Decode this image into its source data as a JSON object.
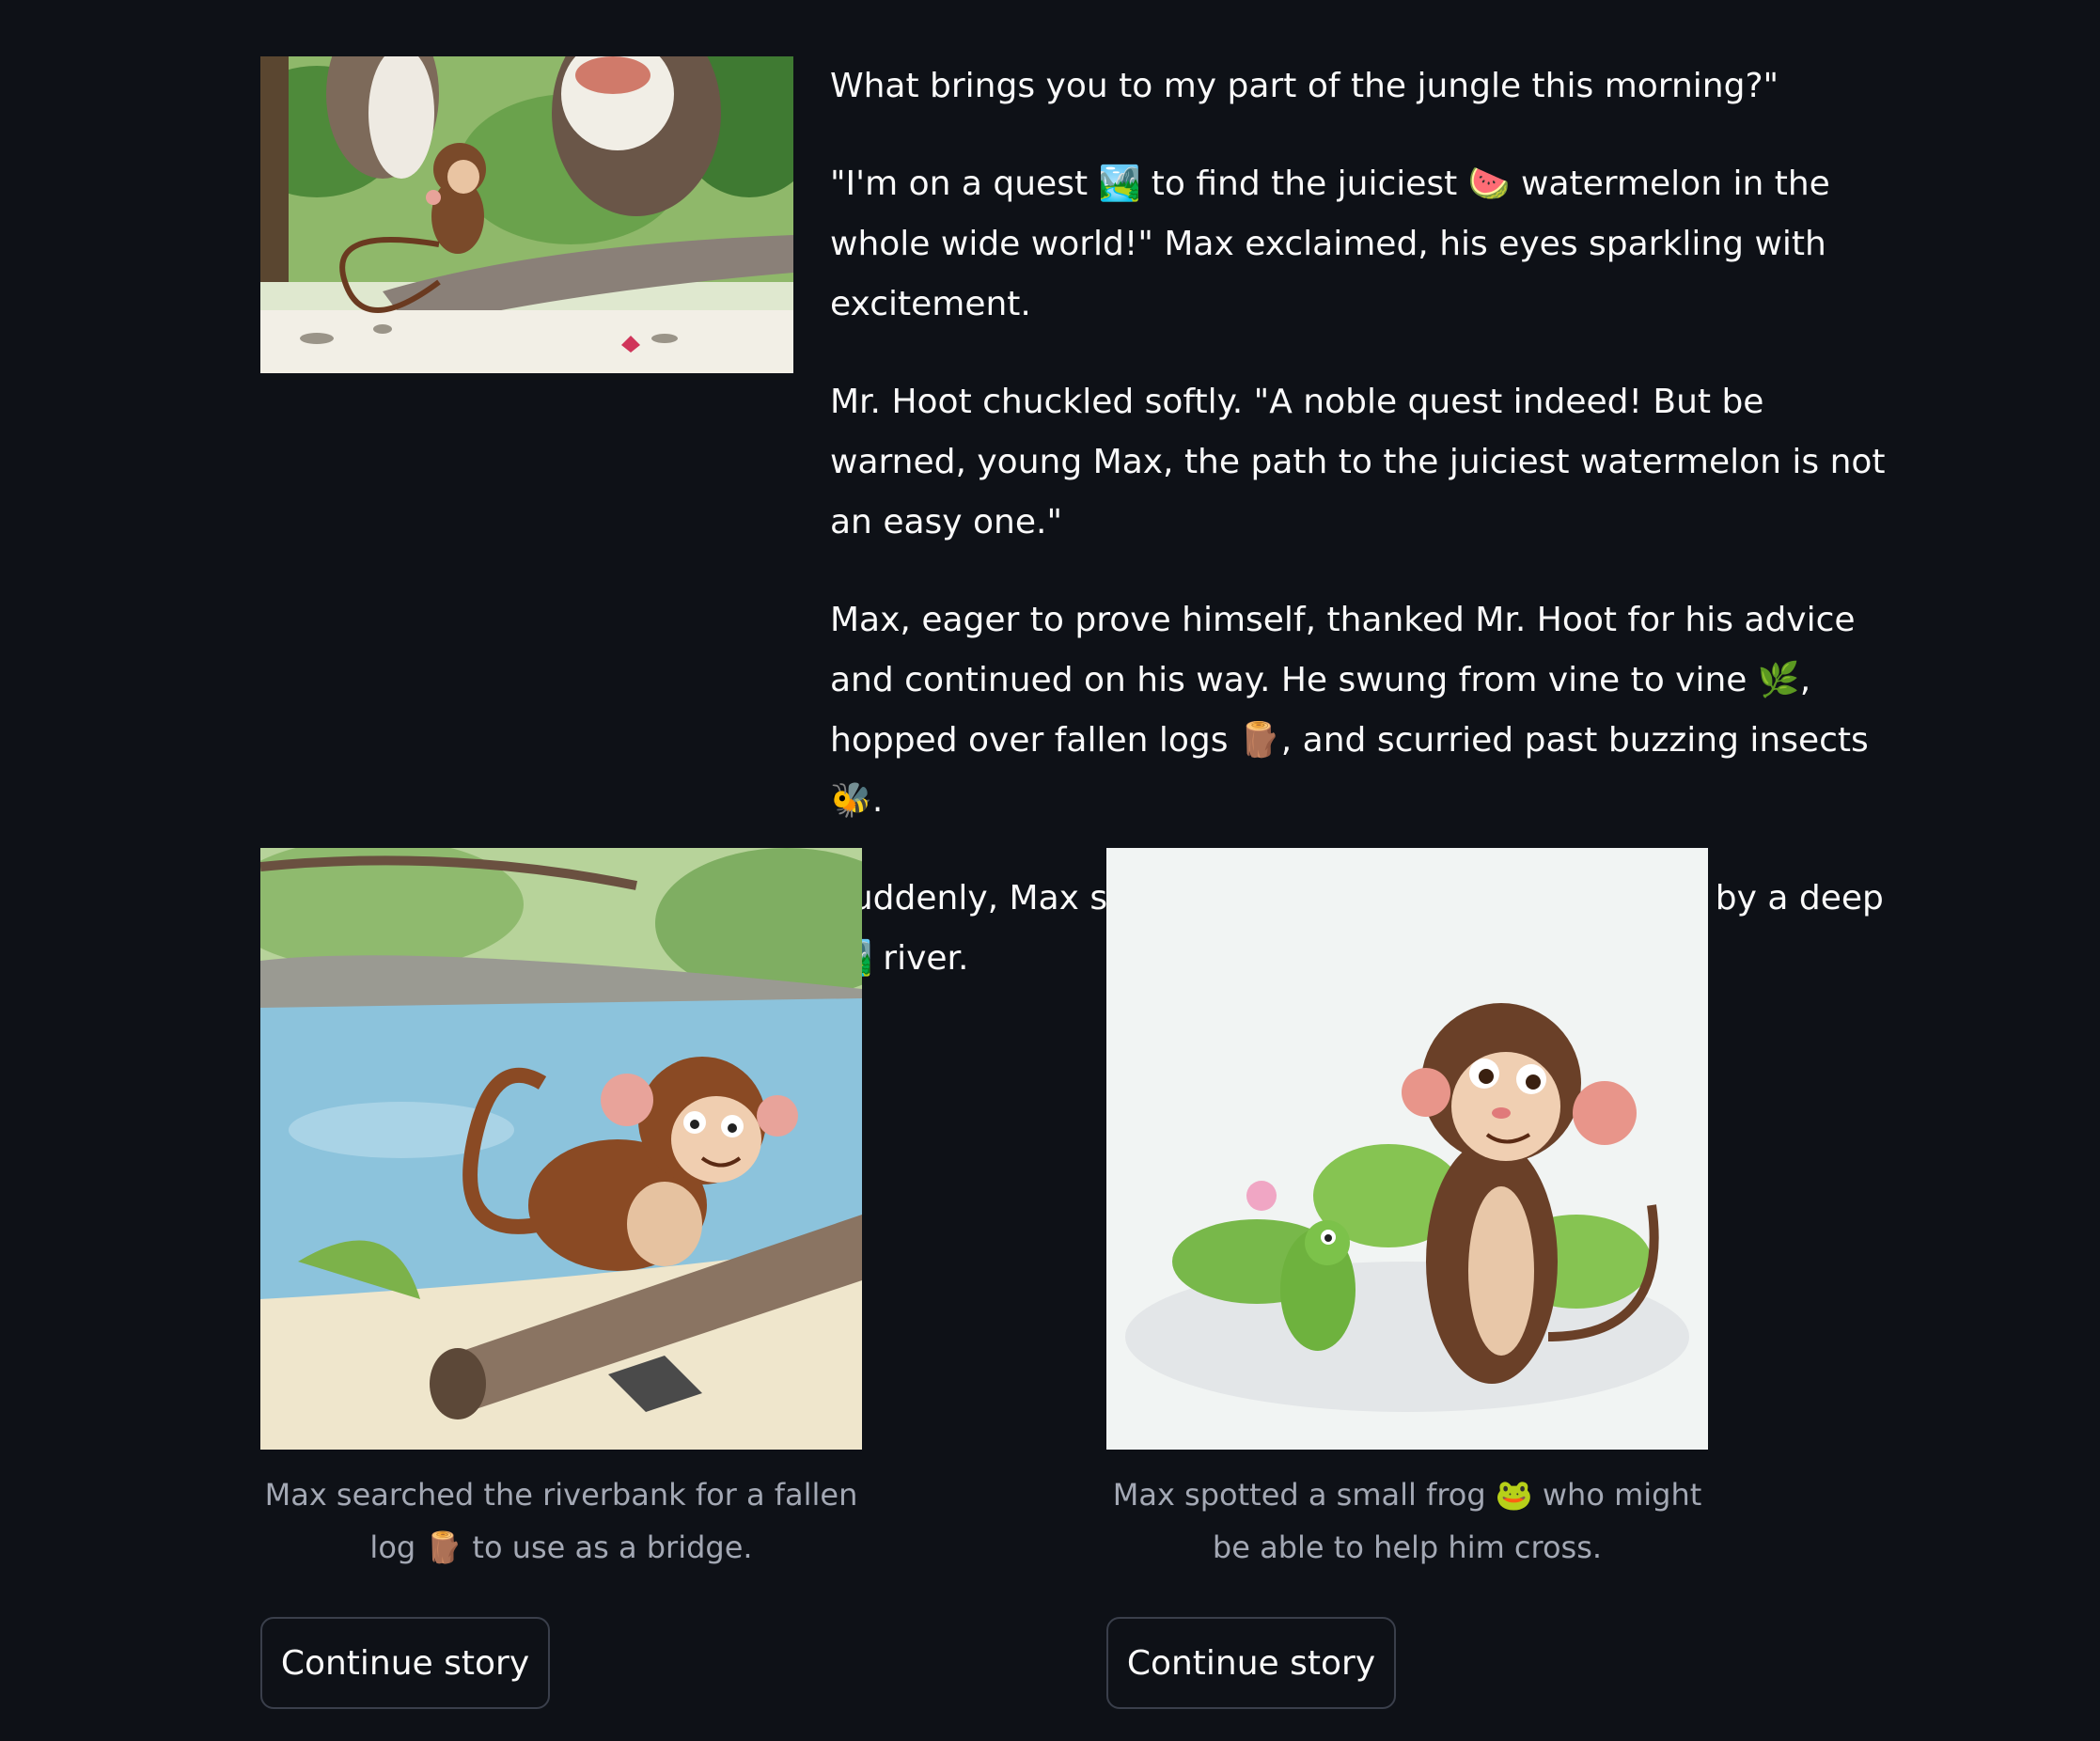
{
  "story": {
    "paragraphs": [
      "What brings you to my part of the jungle this morning?\"",
      "\"I'm on a quest 🏞️ to find the juiciest 🍉 watermelon in the whole wide world!\" Max exclaimed, his eyes sparkling with excitement.",
      "Mr. Hoot chuckled softly. \"A noble quest indeed! But be warned, young Max, the path to the juiciest watermelon is not an easy one.\"",
      "Max, eager to prove himself, thanked Mr. Hoot for his advice and continued on his way. He swung from vine to vine 🌿, hopped over fallen logs 🪵, and scurried past buzzing insects 🐝.",
      "Suddenly, Max stopped short. His path was blocked by a deep 🏞️ river."
    ]
  },
  "options": [
    {
      "caption": "Max searched the riverbank for a fallen log 🪵 to use as a bridge.",
      "button_label": "Continue story"
    },
    {
      "caption": "Max spotted a small frog 🐸 who might be able to help him cross.",
      "button_label": "Continue story"
    }
  ]
}
